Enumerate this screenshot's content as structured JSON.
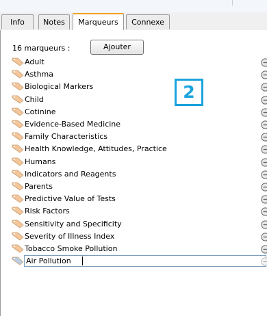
{
  "tabs": [
    {
      "label": "Info",
      "active": false
    },
    {
      "label": "Notes",
      "active": false
    },
    {
      "label": "Marqueurs",
      "active": true
    },
    {
      "label": "Connexe",
      "active": false
    }
  ],
  "tags_panel": {
    "count_label": "16 marqueurs :",
    "add_button": "Ajouter",
    "tags": [
      "Adult",
      "Asthma",
      "Biological Markers",
      "Child",
      "Cotinine",
      "Evidence-Based Medicine",
      "Family Characteristics",
      "Health Knowledge, Attitudes, Practice",
      "Humans",
      "Indicators and Reagents",
      "Parents",
      "Predictive Value of Tests",
      "Risk Factors",
      "Sensitivity and Specificity",
      "Severity of Illness Index",
      "Tobacco Smoke Pollution"
    ],
    "new_tag_value": "Air Pollution"
  },
  "annotation_badge": "2",
  "colors": {
    "tag_icon": "#f3c79b",
    "tag_icon_new": "#b9cde3",
    "badge": "#1aa3dc",
    "active_tab_accent": "#f2a21d"
  },
  "icons": {
    "tag": "tag-icon",
    "remove": "minus-circle-icon"
  }
}
